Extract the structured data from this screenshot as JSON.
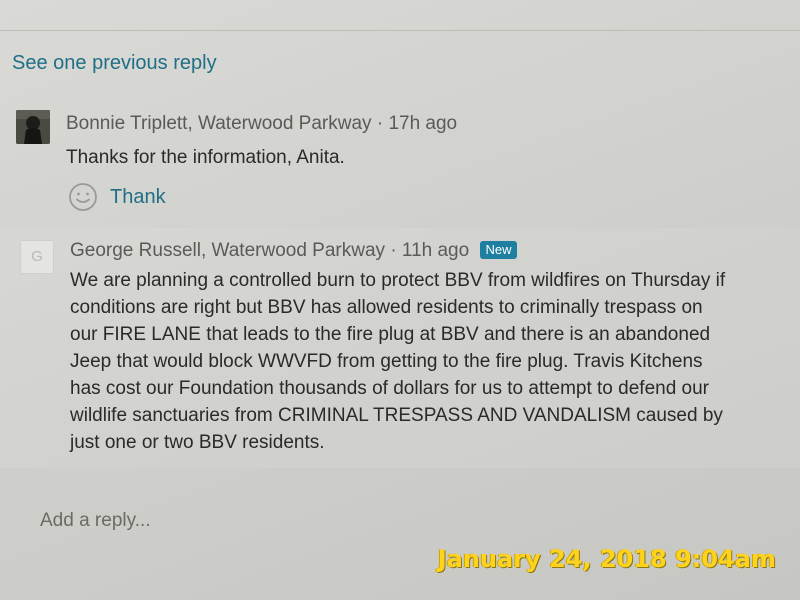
{
  "thread": {
    "see_previous": "See one previous reply"
  },
  "replies": [
    {
      "author": "Bonnie Triplett, Waterwood Parkway",
      "separator": "·",
      "time": "17h ago",
      "body": "Thanks for the information, Anita.",
      "thank_label": "Thank",
      "avatar_icon": "profile-photo-icon"
    },
    {
      "author": "George Russell, Waterwood Parkway",
      "separator": "·",
      "time": "11h ago",
      "badge": "New",
      "avatar_letter": "G",
      "body_lines": [
        "We are planning a controlled burn to protect BBV from wildfires on Thursday if",
        "conditions are right but BBV has allowed residents to criminally trespass on",
        "our FIRE LANE that leads to the fire plug at BBV and there is an abandoned",
        "Jeep that would block WWVFD from getting to the fire plug.   Travis Kitchens",
        "has cost our Foundation thousands of dollars for us to attempt to defend our",
        "wildlife sanctuaries from CRIMINAL TRESPASS AND VANDALISM caused by",
        "just one or two BBV residents."
      ]
    }
  ],
  "reply_box": {
    "placeholder": "Add a reply..."
  },
  "overlay": {
    "timestamp": "January 24, 2018 9:04am"
  },
  "colors": {
    "link": "#1f6f86",
    "badge": "#1f7fa0",
    "timestamp": "#ffd21f"
  }
}
